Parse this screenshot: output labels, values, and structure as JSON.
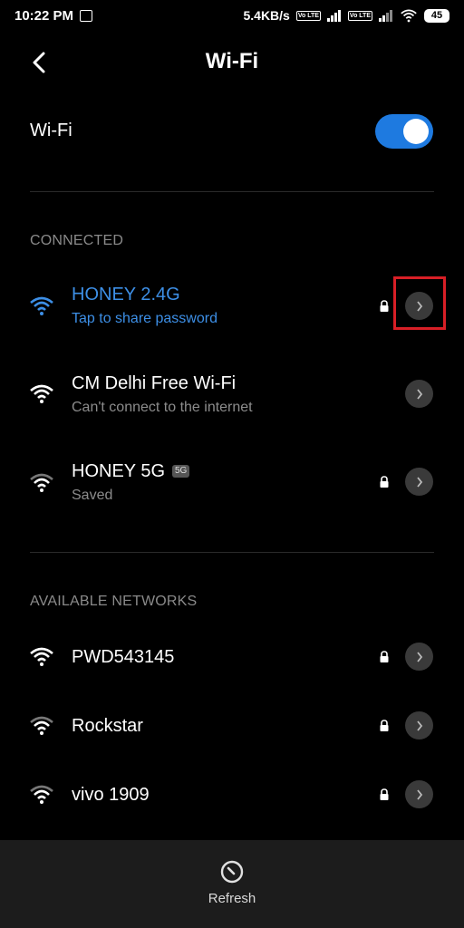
{
  "status_bar": {
    "time": "10:22 PM",
    "speed": "5.4KB/s",
    "volte_label": "Vo LTE",
    "battery": "45"
  },
  "header": {
    "title": "Wi-Fi"
  },
  "wifi_toggle": {
    "label": "Wi-Fi",
    "state": "on"
  },
  "sections": {
    "connected": "CONNECTED",
    "available": "AVAILABLE NETWORKS"
  },
  "connected_networks": [
    {
      "name": "HONEY 2.4G",
      "subtitle": "Tap to share password",
      "locked": true,
      "active": true
    },
    {
      "name": "CM Delhi Free Wi-Fi",
      "subtitle": "Can't connect to the internet",
      "locked": false
    },
    {
      "name": "HONEY 5G",
      "badge": "5G",
      "subtitle": "Saved",
      "locked": true
    }
  ],
  "available_networks": [
    {
      "name": "PWD543145",
      "locked": true
    },
    {
      "name": "Rockstar",
      "locked": true
    },
    {
      "name": "vivo 1909",
      "locked": true
    }
  ],
  "bottom_bar": {
    "refresh_label": "Refresh"
  },
  "colors": {
    "accent": "#1e7ae0",
    "connected_text": "#3d8fe6",
    "highlight": "#d81f26"
  }
}
